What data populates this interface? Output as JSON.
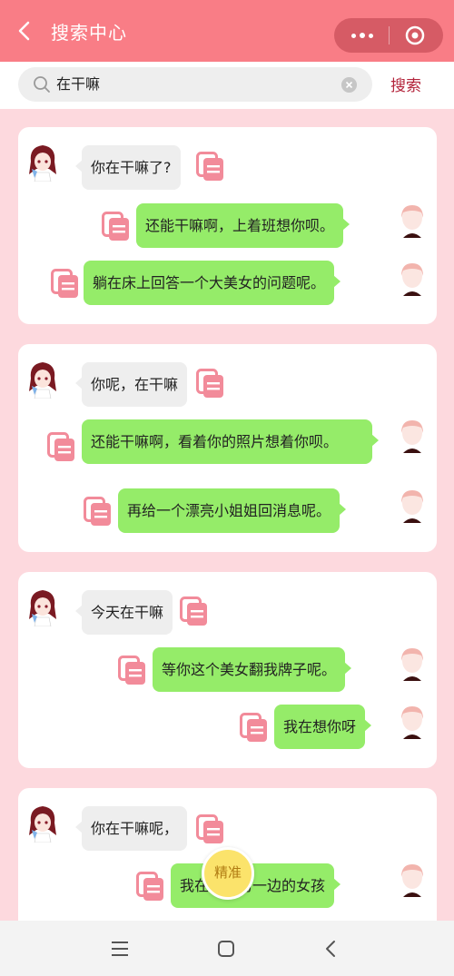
{
  "header": {
    "title": "搜索中心",
    "back_icon": "chevron-left-icon",
    "more_icon": "more-dots-icon",
    "close_icon": "target-circle-icon",
    "color": "#f97d86"
  },
  "search": {
    "query": "在干嘛",
    "button_label": "搜索"
  },
  "cards": [
    {
      "messages": [
        {
          "side": "left",
          "text": "你在干嘛了?"
        },
        {
          "side": "right",
          "text": "还能干嘛啊，上着班想你呗。"
        },
        {
          "side": "right",
          "text": "躺在床上回答一个大美女的问题呢。"
        }
      ]
    },
    {
      "messages": [
        {
          "side": "left",
          "text": "你呢，在干嘛"
        },
        {
          "side": "right",
          "text": "还能干嘛啊，看着你的照片想着你呗。"
        },
        {
          "side": "right",
          "text": "再给一个漂亮小姐姐回消息呢。"
        }
      ]
    },
    {
      "messages": [
        {
          "side": "left",
          "text": "今天在干嘛"
        },
        {
          "side": "right",
          "text": "等你这个美女翻我牌子呢。"
        },
        {
          "side": "right",
          "text": "我在想你呀"
        }
      ]
    },
    {
      "messages": [
        {
          "side": "left",
          "text": "你在干嘛呢，"
        },
        {
          "side": "right",
          "text": "我在屏幕另一边的女孩"
        }
      ]
    }
  ],
  "float_tag": "精准",
  "colors": {
    "page_bg": "#fdd9de",
    "bubble_right": "#95ec69",
    "bubble_left": "#eeeeee",
    "copy_icon": "#f28b9a",
    "accent": "#b3243b"
  },
  "navbar": {
    "icons": [
      "menu-icon",
      "home-square-icon",
      "back-icon"
    ]
  }
}
